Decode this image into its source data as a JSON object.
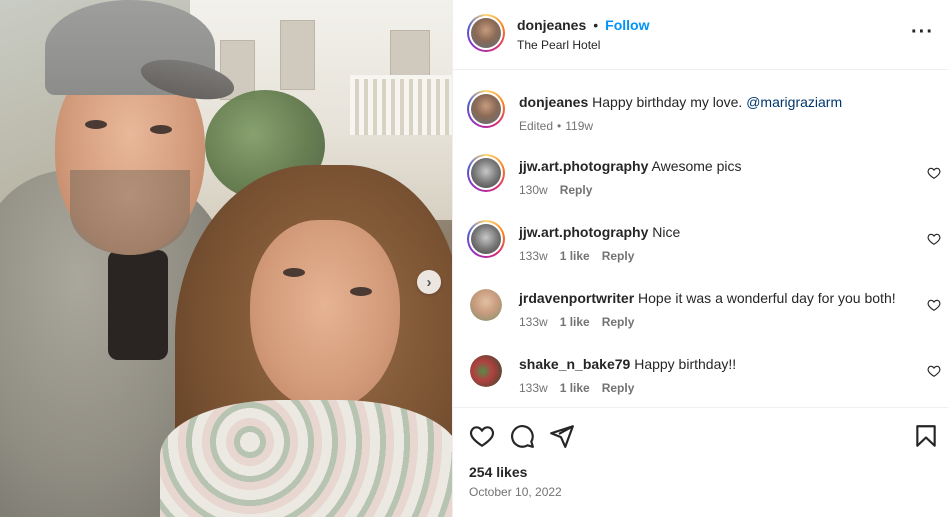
{
  "post": {
    "author": "donjeanes",
    "separator": "•",
    "follow_label": "Follow",
    "location": "The Pearl Hotel",
    "more_label": "···"
  },
  "caption": {
    "username": "donjeanes",
    "text": "Happy birthday my love.",
    "mention": "@marigraziarm",
    "edited": "Edited",
    "age": "119w"
  },
  "comments": [
    {
      "username": "jjw.art.photography",
      "text": "Awesome pics",
      "age": "130w",
      "likes": "",
      "reply": "Reply"
    },
    {
      "username": "jjw.art.photography",
      "text": "Nice",
      "age": "133w",
      "likes": "1 like",
      "reply": "Reply"
    },
    {
      "username": "jrdavenportwriter",
      "text": "Hope it was a wonderful day for you both!",
      "age": "133w",
      "likes": "1 like",
      "reply": "Reply"
    },
    {
      "username": "shake_n_bake79",
      "text": "Happy birthday!!",
      "age": "133w",
      "likes": "1 like",
      "reply": "Reply"
    }
  ],
  "stats": {
    "likes": "254 likes",
    "date": "October 10, 2022"
  },
  "carousel": {
    "next_glyph": "›"
  },
  "icons": {
    "heart": "heart-icon",
    "comment": "comment-icon",
    "share": "share-icon",
    "save": "bookmark-icon"
  },
  "colors": {
    "link": "#0095f6",
    "mention": "#00376b",
    "muted": "#737373"
  }
}
